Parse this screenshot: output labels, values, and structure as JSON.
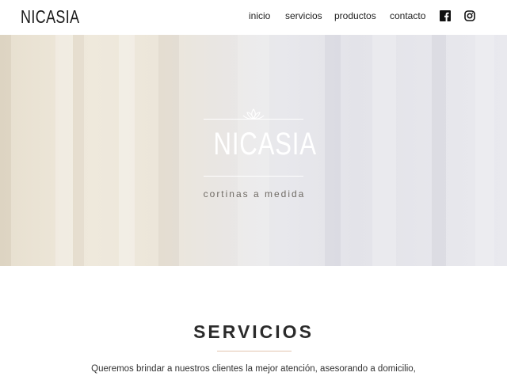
{
  "header": {
    "logo": "NICASIA",
    "nav": [
      {
        "label": "inicio"
      },
      {
        "label": "servicios"
      },
      {
        "label": "productos"
      },
      {
        "label": "contacto"
      }
    ],
    "social": [
      {
        "icon": "facebook-icon"
      },
      {
        "icon": "instagram-icon"
      }
    ]
  },
  "hero": {
    "title": "NICASIA",
    "subtitle": "cortinas a medida",
    "icon": "lotus-icon"
  },
  "services": {
    "title": "SERVICIOS",
    "text_line1": "Queremos brindar a nuestros clientes la mejor atención, asesorando a domicilio,",
    "rule_color": "#e2c4ae"
  }
}
